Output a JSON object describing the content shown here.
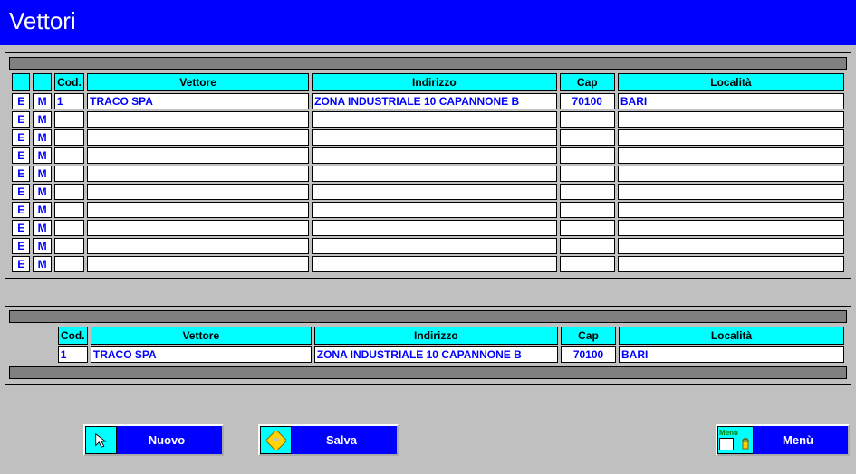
{
  "title": "Vettori",
  "columns": {
    "cod": "Cod.",
    "vettore": "Vettore",
    "indirizzo": "Indirizzo",
    "cap": "Cap",
    "localita": "Località"
  },
  "row_buttons": {
    "e": "E",
    "m": "M"
  },
  "rows": [
    {
      "cod": "1",
      "vettore": "TRACO SPA",
      "indirizzo": "ZONA INDUSTRIALE 10 CAPANNONE B",
      "cap": "70100",
      "localita": "BARI"
    },
    {
      "cod": "",
      "vettore": "",
      "indirizzo": "",
      "cap": "",
      "localita": ""
    },
    {
      "cod": "",
      "vettore": "",
      "indirizzo": "",
      "cap": "",
      "localita": ""
    },
    {
      "cod": "",
      "vettore": "",
      "indirizzo": "",
      "cap": "",
      "localita": ""
    },
    {
      "cod": "",
      "vettore": "",
      "indirizzo": "",
      "cap": "",
      "localita": ""
    },
    {
      "cod": "",
      "vettore": "",
      "indirizzo": "",
      "cap": "",
      "localita": ""
    },
    {
      "cod": "",
      "vettore": "",
      "indirizzo": "",
      "cap": "",
      "localita": ""
    },
    {
      "cod": "",
      "vettore": "",
      "indirizzo": "",
      "cap": "",
      "localita": ""
    },
    {
      "cod": "",
      "vettore": "",
      "indirizzo": "",
      "cap": "",
      "localita": ""
    },
    {
      "cod": "",
      "vettore": "",
      "indirizzo": "",
      "cap": "",
      "localita": ""
    }
  ],
  "detail": {
    "cod": "1",
    "vettore": "TRACO SPA",
    "indirizzo": "ZONA INDUSTRIALE 10 CAPANNONE B",
    "cap": "70100",
    "localita": "BARI"
  },
  "buttons": {
    "nuovo": "Nuovo",
    "salva": "Salva",
    "menu": "Menù",
    "menu_icon_text": "Menù"
  }
}
